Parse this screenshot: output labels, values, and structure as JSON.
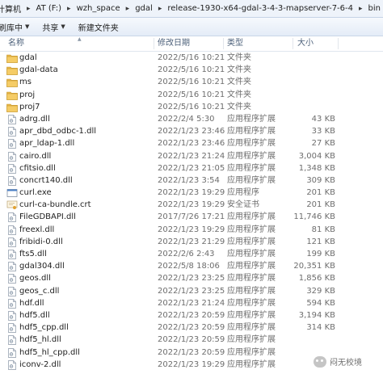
{
  "address_bar": {
    "crumbs": [
      "计算机",
      "AT (F:)",
      "wzh_space",
      "gdal",
      "release-1930-x64-gdal-3-4-3-mapserver-7-6-4",
      "bin"
    ]
  },
  "toolbar": {
    "organize_label": "刷库中",
    "share_label": "共享",
    "new_folder_label": "新建文件夹"
  },
  "columns": {
    "name": "名称",
    "date": "修改日期",
    "type": "类型",
    "size": "大小"
  },
  "files": [
    {
      "name": "gdal",
      "date": "2022/5/16 10:21",
      "type": "文件夹",
      "size": "",
      "icon": "folder-icon"
    },
    {
      "name": "gdal-data",
      "date": "2022/5/16 10:21",
      "type": "文件夹",
      "size": "",
      "icon": "folder-icon"
    },
    {
      "name": "ms",
      "date": "2022/5/16 10:21",
      "type": "文件夹",
      "size": "",
      "icon": "folder-icon"
    },
    {
      "name": "proj",
      "date": "2022/5/16 10:21",
      "type": "文件夹",
      "size": "",
      "icon": "folder-icon"
    },
    {
      "name": "proj7",
      "date": "2022/5/16 10:21",
      "type": "文件夹",
      "size": "",
      "icon": "folder-icon"
    },
    {
      "name": "adrg.dll",
      "date": "2022/2/4 5:30",
      "type": "应用程序扩展",
      "size": "43 KB",
      "icon": "dll-icon"
    },
    {
      "name": "apr_dbd_odbc-1.dll",
      "date": "2022/1/23 23:46",
      "type": "应用程序扩展",
      "size": "33 KB",
      "icon": "dll-icon"
    },
    {
      "name": "apr_ldap-1.dll",
      "date": "2022/1/23 23:46",
      "type": "应用程序扩展",
      "size": "27 KB",
      "icon": "dll-icon"
    },
    {
      "name": "cairo.dll",
      "date": "2022/1/23 21:24",
      "type": "应用程序扩展",
      "size": "3,004 KB",
      "icon": "dll-icon"
    },
    {
      "name": "cfitsio.dll",
      "date": "2022/1/23 21:05",
      "type": "应用程序扩展",
      "size": "1,348 KB",
      "icon": "dll-icon"
    },
    {
      "name": "concrt140.dll",
      "date": "2022/1/23 3:54",
      "type": "应用程序扩展",
      "size": "309 KB",
      "icon": "dll-icon"
    },
    {
      "name": "curl.exe",
      "date": "2022/1/23 19:29",
      "type": "应用程序",
      "size": "201 KB",
      "icon": "exe-icon"
    },
    {
      "name": "curl-ca-bundle.crt",
      "date": "2022/1/23 19:29",
      "type": "安全证书",
      "size": "201 KB",
      "icon": "cert-icon"
    },
    {
      "name": "FileGDBAPI.dll",
      "date": "2017/7/26 17:21",
      "type": "应用程序扩展",
      "size": "11,746 KB",
      "icon": "dll-icon"
    },
    {
      "name": "freexl.dll",
      "date": "2022/1/23 19:29",
      "type": "应用程序扩展",
      "size": "81 KB",
      "icon": "dll-icon"
    },
    {
      "name": "fribidi-0.dll",
      "date": "2022/1/23 21:29",
      "type": "应用程序扩展",
      "size": "121 KB",
      "icon": "dll-icon"
    },
    {
      "name": "fts5.dll",
      "date": "2022/2/6 2:43",
      "type": "应用程序扩展",
      "size": "199 KB",
      "icon": "dll-icon"
    },
    {
      "name": "gdal304.dll",
      "date": "2022/5/8 18:06",
      "type": "应用程序扩展",
      "size": "20,351 KB",
      "icon": "dll-icon"
    },
    {
      "name": "geos.dll",
      "date": "2022/1/23 23:25",
      "type": "应用程序扩展",
      "size": "1,856 KB",
      "icon": "dll-icon"
    },
    {
      "name": "geos_c.dll",
      "date": "2022/1/23 23:25",
      "type": "应用程序扩展",
      "size": "329 KB",
      "icon": "dll-icon"
    },
    {
      "name": "hdf.dll",
      "date": "2022/1/23 21:24",
      "type": "应用程序扩展",
      "size": "594 KB",
      "icon": "dll-icon"
    },
    {
      "name": "hdf5.dll",
      "date": "2022/1/23 20:59",
      "type": "应用程序扩展",
      "size": "3,194 KB",
      "icon": "dll-icon"
    },
    {
      "name": "hdf5_cpp.dll",
      "date": "2022/1/23 20:59",
      "type": "应用程序扩展",
      "size": "314 KB",
      "icon": "dll-icon"
    },
    {
      "name": "hdf5_hl.dll",
      "date": "2022/1/23 20:59",
      "type": "应用程序扩展",
      "size": "",
      "icon": "dll-icon"
    },
    {
      "name": "hdf5_hl_cpp.dll",
      "date": "2022/1/23 20:59",
      "type": "应用程序扩展",
      "size": "",
      "icon": "dll-icon"
    },
    {
      "name": "iconv-2.dll",
      "date": "2022/1/23 19:29",
      "type": "应用程序扩展",
      "size": "",
      "icon": "dll-icon"
    }
  ],
  "watermark": {
    "text": "闷无校境"
  },
  "colors": {
    "folder": "#e8b84a",
    "header_text": "#4c607a",
    "toolbar_bg": "#e4ecf7"
  }
}
